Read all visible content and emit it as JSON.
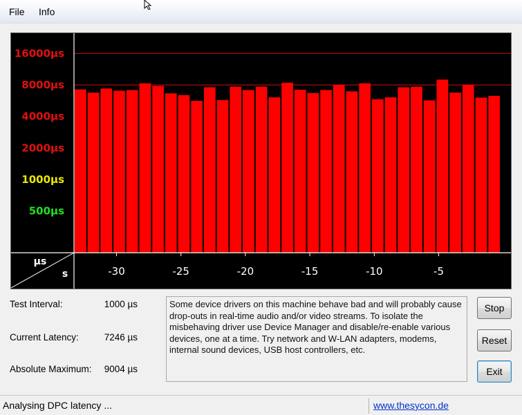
{
  "menu": {
    "file": "File",
    "info": "Info"
  },
  "chart_data": {
    "type": "bar",
    "y_axis_unit": "µs",
    "x_axis_unit": "s",
    "y_scale": "log",
    "ylim": [
      200,
      25000
    ],
    "xlim": [
      -33.3,
      -0.2
    ],
    "y_ticks": [
      {
        "value": 16000,
        "label": "16000µs",
        "color": "#e01010"
      },
      {
        "value": 8000,
        "label": "8000µs",
        "color": "#e01010"
      },
      {
        "value": 4000,
        "label": "4000µs",
        "color": "#e01010"
      },
      {
        "value": 2000,
        "label": "2000µs",
        "color": "#e01010"
      },
      {
        "value": 1000,
        "label": "1000µs",
        "color": "#e8e800"
      },
      {
        "value": 500,
        "label": "500µs",
        "color": "#22dd22"
      }
    ],
    "gridlines": [
      16000,
      8000
    ],
    "x_ticks": [
      -30,
      -25,
      -20,
      -15,
      -10,
      -5
    ],
    "bar_color": "#ff0000",
    "values": [
      7250,
      6750,
      7400,
      7050,
      7150,
      8300,
      7850,
      6650,
      6400,
      5650,
      7600,
      5750,
      7700,
      7150,
      7700,
      6100,
      8400,
      7200,
      6700,
      7150,
      8000,
      6950,
      8300,
      5850,
      6100,
      7600,
      7700,
      5700,
      9000,
      6750,
      8000,
      6050,
      6300
    ]
  },
  "info": {
    "test_interval_label": "Test Interval:",
    "test_interval_value": "1000 µs",
    "current_latency_label": "Current Latency:",
    "current_latency_value": "7246 µs",
    "absolute_max_label": "Absolute Maximum:",
    "absolute_max_value": "9004 µs"
  },
  "message": "Some device drivers on this machine behave bad and will probably cause drop-outs in real-time audio and/or video streams. To isolate the misbehaving driver use Device Manager and disable/re-enable various devices, one at a time. Try network and W-LAN adapters, modems, internal sound devices, USB host controllers, etc.",
  "buttons": {
    "stop": "Stop",
    "reset": "Reset",
    "exit": "Exit"
  },
  "status": {
    "text": "Analysing DPC latency ...",
    "link": "www.thesycon.de"
  }
}
